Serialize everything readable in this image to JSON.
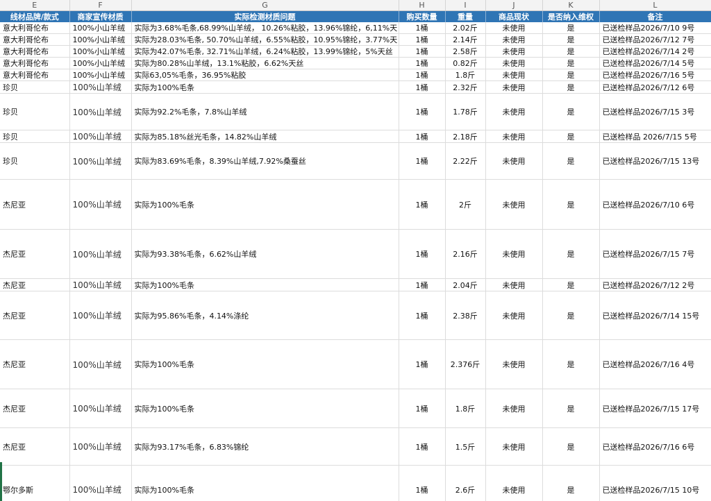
{
  "columns": [
    "E",
    "F",
    "G",
    "H",
    "I",
    "J",
    "K",
    "L"
  ],
  "header": [
    "线材品牌/款式",
    "商家宣传材质",
    "实际检测材质问题",
    "购买数量",
    "重量",
    "商品现状",
    "是否纳入维权",
    "备注"
  ],
  "rows": [
    {
      "brand": "意大利哥伦布",
      "claimed": "100%小山羊绒",
      "actual": "实际为3.68%毛条,68.99%山羊绒， 10.26%粘胶，13.96%锦纶，6,11%天",
      "qty": "1桶",
      "weight": "2.02斤",
      "status": "未使用",
      "included": "是",
      "note": "已送检样品2026/7/10 9号"
    },
    {
      "brand": "意大利哥伦布",
      "claimed": "100%小山羊绒",
      "actual": "实际为28.03%毛条, 50.70%山羊绒，6.55%粘胶，10.95%锦纶，3.77%天",
      "qty": "1桶",
      "weight": "2.14斤",
      "status": "未使用",
      "included": "是",
      "note": "已送检样品2026/7/12 7号"
    },
    {
      "brand": "意大利哥伦布",
      "claimed": "100%小山羊绒",
      "actual": "实际为42.07%毛条, 32.71%山羊绒，6.24%粘胶，13.99%锦纶，5%天丝",
      "qty": "1桶",
      "weight": "2.58斤",
      "status": "未使用",
      "included": "是",
      "note": "已送检样品2026/7/14 2号"
    },
    {
      "brand": "意大利哥伦布",
      "claimed": "100%小山羊绒",
      "actual": "实际为80.28%山羊绒，13.1%粘胶，6.62%天丝",
      "qty": "1桶",
      "weight": "0.82斤",
      "status": "未使用",
      "included": "是",
      "note": "已送检样品2026/7/14 5号"
    },
    {
      "brand": "意大利哥伦布",
      "claimed": "100%小山羊绒",
      "actual": "实际63,05%毛条，36.95%粘胶",
      "qty": "1桶",
      "weight": "1.8斤",
      "status": "未使用",
      "included": "是",
      "note": "已送检样品2026/7/16 5号"
    },
    {
      "brand": "珍贝",
      "claimed": "100%山羊绒",
      "actual": "实际为100%毛条",
      "qty": "1桶",
      "weight": "2.32斤",
      "status": "未使用",
      "included": "是",
      "note": "已送检样品2026/7/12 6号"
    },
    {
      "brand": "珍贝",
      "claimed": "100%山羊绒",
      "actual": "实际为92.2%毛条，7.8%山羊绒",
      "qty": "1桶",
      "weight": "1.78斤",
      "status": "未使用",
      "included": "是",
      "note": "已送检样品2026/7/15 3号"
    },
    {
      "brand": "珍贝",
      "claimed": "100%山羊绒",
      "actual": "实际为85.18%丝光毛条，14.82%山羊绒",
      "qty": "1桶",
      "weight": "2.18斤",
      "status": "未使用",
      "included": "是",
      "note": "已送检样品 2026/7/15 5号"
    },
    {
      "brand": "珍贝",
      "claimed": "100%山羊绒",
      "actual": "实际为83.69%毛条，8.39%山羊绒,7.92%桑蚕丝",
      "qty": "1桶",
      "weight": "2.22斤",
      "status": "未使用",
      "included": "是",
      "note": "已送检样品2026/7/15 13号"
    },
    {
      "brand": "杰尼亚",
      "claimed": "100%山羊绒",
      "actual": "实际为100%毛条",
      "qty": "1桶",
      "weight": "2斤",
      "status": "未使用",
      "included": "是",
      "note": "已送检样品2026/7/10 6号"
    },
    {
      "brand": "杰尼亚",
      "claimed": "100%山羊绒",
      "actual": "实际为93.38%毛条，6.62%山羊绒",
      "qty": "1桶",
      "weight": "2.16斤",
      "status": "未使用",
      "included": "是",
      "note": "已送检样品2026/7/15 7号"
    },
    {
      "brand": "杰尼亚",
      "claimed": "100%山羊绒",
      "actual": "实际为100%毛条",
      "qty": "1桶",
      "weight": "2.04斤",
      "status": "未使用",
      "included": "是",
      "note": "已送检样品2026/7/12 2号"
    },
    {
      "brand": "杰尼亚",
      "claimed": "100%山羊绒",
      "actual": "实际为95.86%毛条，4.14%涤纶",
      "qty": "1桶",
      "weight": "2.38斤",
      "status": "未使用",
      "included": "是",
      "note": "已送检样品2026/7/14 15号"
    },
    {
      "brand": "杰尼亚",
      "claimed": "100%山羊绒",
      "actual": "实际为100%毛条",
      "qty": "1桶",
      "weight": "2.376斤",
      "status": "未使用",
      "included": "是",
      "note": "已送检样品2026/7/16 4号"
    },
    {
      "brand": "杰尼亚",
      "claimed": "100%山羊绒",
      "actual": "实际为100%毛条",
      "qty": "1桶",
      "weight": "1.8斤",
      "status": "未使用",
      "included": "是",
      "note": "已送检样品2026/7/15 17号"
    },
    {
      "brand": "杰尼亚",
      "claimed": "100%山羊绒",
      "actual": "实际为93.17%毛条，6.83%锦纶",
      "qty": "1桶",
      "weight": "1.5斤",
      "status": "未使用",
      "included": "是",
      "note": "已送检样品2026/7/16 6号"
    },
    {
      "brand": "鄂尔多斯",
      "claimed": "100%山羊绒",
      "actual": "实际为100%毛条",
      "qty": "1桶",
      "weight": "2.6斤",
      "status": "未使用",
      "included": "是",
      "note": "已送检样品2026/7/15 10号"
    }
  ]
}
